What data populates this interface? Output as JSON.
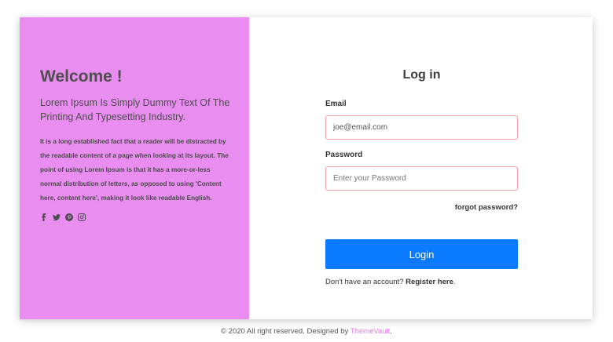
{
  "panel": {
    "welcome": "Welcome !",
    "tagline": "Lorem Ipsum Is Simply Dummy Text Of The Printing And Typesetting Industry.",
    "description": "It is a long established fact that a reader will be distracted by the readable content of a page when looking at its layout. The point of using Lorem Ipsum is that it has a more-or-less normal distribution of letters, as opposed to using 'Content here, content here', making it look like readable English.",
    "social_icons": [
      "facebook-icon",
      "twitter-icon",
      "pinterest-icon",
      "instagram-icon"
    ],
    "background": "#e98ef0"
  },
  "form": {
    "title": "Log in",
    "email_label": "Email",
    "email_value": "joe@email.com",
    "password_label": "Password",
    "password_placeholder": "Enter your Password",
    "forgot": "forgot password?",
    "login_label": "Login",
    "signup_text": "Don't have an account?",
    "signup_link": "Register here",
    "signup_end": ".",
    "accent": "#0a7bff",
    "input_border": "#f0a2a8"
  },
  "footer": {
    "text": "© 2020 All right reserved. Designed by",
    "brand": "ThemeVault",
    "end": ".",
    "brand_color": "#e27be8"
  }
}
